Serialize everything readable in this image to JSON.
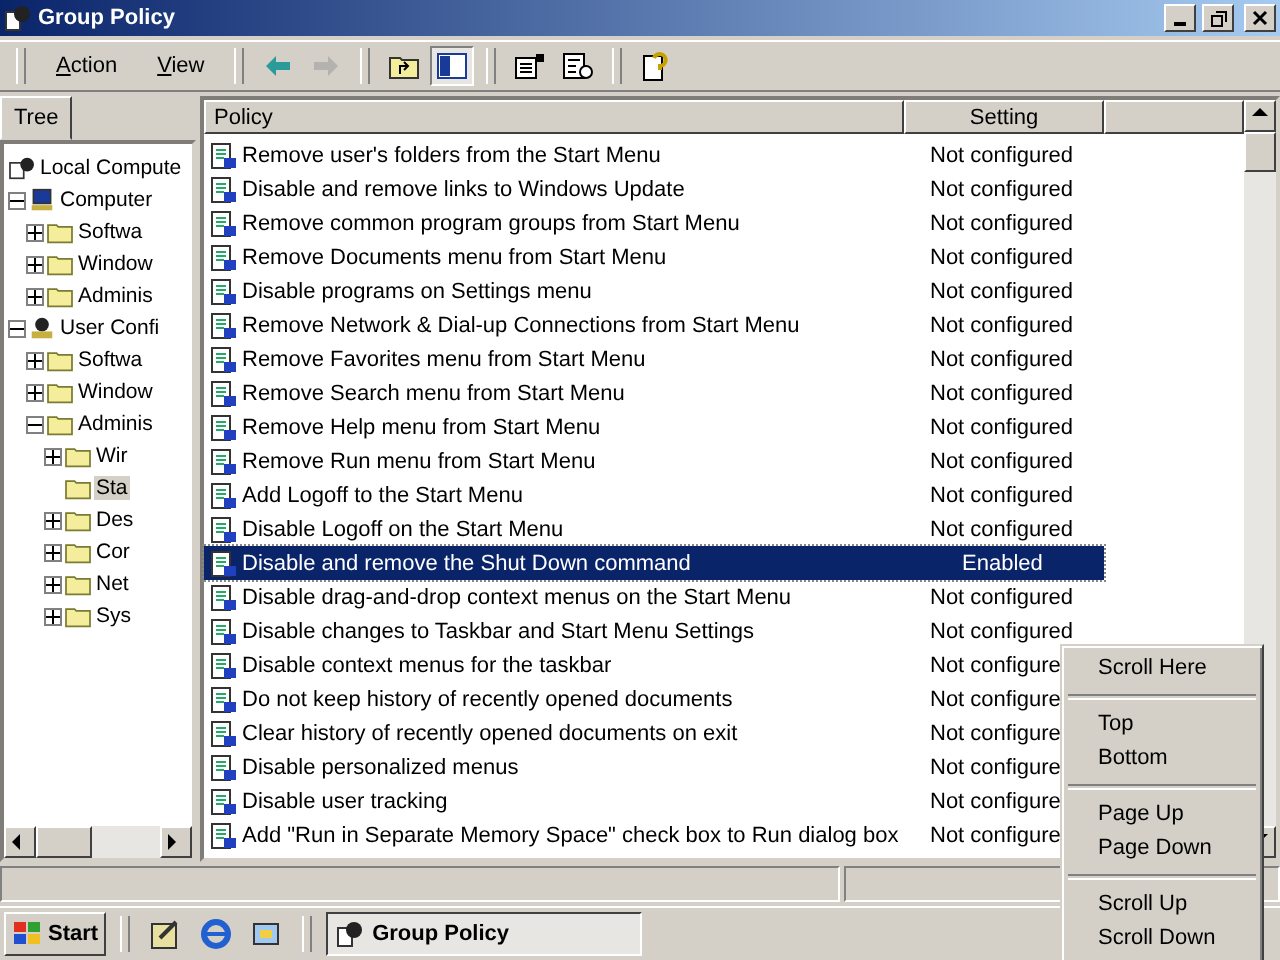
{
  "window": {
    "title": "Group Policy"
  },
  "menu": [
    "Action",
    "View"
  ],
  "toolbar": [
    {
      "kind": "back",
      "disabled": false
    },
    {
      "kind": "forward",
      "disabled": true
    },
    {
      "kind": "sep"
    },
    {
      "kind": "up",
      "disabled": false
    },
    {
      "kind": "tree",
      "disabled": false,
      "pressed": true
    },
    {
      "kind": "sep"
    },
    {
      "kind": "properties",
      "disabled": false
    },
    {
      "kind": "export",
      "disabled": false
    },
    {
      "kind": "sep"
    },
    {
      "kind": "help",
      "disabled": false
    }
  ],
  "tabs": [
    {
      "label": "Tree",
      "selected": true
    }
  ],
  "tree": [
    {
      "label": "Local Compute",
      "kind": "root",
      "selected": false,
      "children": [
        {
          "label": "Computer",
          "kind": "computer",
          "expanded": true,
          "selected": false,
          "children": [
            {
              "label": "Softwa",
              "kind": "folder",
              "expanded": false,
              "selected": false
            },
            {
              "label": "Window",
              "kind": "folder",
              "expanded": false,
              "selected": false
            },
            {
              "label": "Adminis",
              "kind": "folder",
              "expanded": false,
              "selected": false
            }
          ]
        },
        {
          "label": "User Confi",
          "kind": "user",
          "expanded": true,
          "selected": false,
          "children": [
            {
              "label": "Softwa",
              "kind": "folder",
              "expanded": false,
              "selected": false
            },
            {
              "label": "Window",
              "kind": "folder",
              "expanded": false,
              "selected": false
            },
            {
              "label": "Adminis",
              "kind": "folder",
              "expanded": true,
              "selected": false,
              "children": [
                {
                  "label": "Wir",
                  "kind": "folder",
                  "expanded": false,
                  "selected": false
                },
                {
                  "label": "Sta",
                  "kind": "folder",
                  "selected": true
                },
                {
                  "label": "Des",
                  "kind": "folder",
                  "expanded": false,
                  "selected": false
                },
                {
                  "label": "Cor",
                  "kind": "folder",
                  "expanded": false,
                  "selected": false
                },
                {
                  "label": "Net",
                  "kind": "folder",
                  "expanded": false,
                  "selected": false
                },
                {
                  "label": "Sys",
                  "kind": "folder",
                  "expanded": false,
                  "selected": false
                }
              ]
            }
          ]
        }
      ]
    }
  ],
  "table": {
    "columns": [
      "Policy",
      "Setting"
    ],
    "rows": [
      {
        "policy": "Remove user's folders from the Start Menu",
        "setting": "Not configured",
        "selected": false
      },
      {
        "policy": "Disable and remove links to Windows Update",
        "setting": "Not configured",
        "selected": false
      },
      {
        "policy": "Remove common program groups from Start Menu",
        "setting": "Not configured",
        "selected": false
      },
      {
        "policy": "Remove Documents menu from Start Menu",
        "setting": "Not configured",
        "selected": false
      },
      {
        "policy": "Disable programs on Settings menu",
        "setting": "Not configured",
        "selected": false
      },
      {
        "policy": "Remove Network & Dial-up Connections from Start Menu",
        "setting": "Not configured",
        "selected": false
      },
      {
        "policy": "Remove Favorites menu from Start Menu",
        "setting": "Not configured",
        "selected": false
      },
      {
        "policy": "Remove Search menu from Start Menu",
        "setting": "Not configured",
        "selected": false
      },
      {
        "policy": "Remove Help menu from Start Menu",
        "setting": "Not configured",
        "selected": false
      },
      {
        "policy": "Remove Run menu from Start Menu",
        "setting": "Not configured",
        "selected": false
      },
      {
        "policy": "Add Logoff to the Start Menu",
        "setting": "Not configured",
        "selected": false
      },
      {
        "policy": "Disable Logoff on the Start Menu",
        "setting": "Not configured",
        "selected": false
      },
      {
        "policy": "Disable and remove the Shut Down command",
        "setting": "Enabled",
        "selected": true
      },
      {
        "policy": "Disable drag-and-drop context menus on the Start Menu",
        "setting": "Not configured",
        "selected": false
      },
      {
        "policy": "Disable changes to Taskbar and Start Menu Settings",
        "setting": "Not configured",
        "selected": false
      },
      {
        "policy": "Disable context menus for the taskbar",
        "setting": "Not configure",
        "selected": false
      },
      {
        "policy": "Do not keep history of recently opened documents",
        "setting": "Not configure",
        "selected": false
      },
      {
        "policy": "Clear history of recently opened documents on exit",
        "setting": "Not configure",
        "selected": false
      },
      {
        "policy": "Disable personalized menus",
        "setting": "Not configure",
        "selected": false
      },
      {
        "policy": "Disable user tracking",
        "setting": "Not configure",
        "selected": false
      },
      {
        "policy": "Add \"Run in Separate Memory Space\" check box to Run dialog box",
        "setting": "Not configure",
        "selected": false
      }
    ]
  },
  "context_menu": [
    {
      "kind": "item",
      "label": "Scroll Here"
    },
    {
      "kind": "sep"
    },
    {
      "kind": "item",
      "label": "Top"
    },
    {
      "kind": "item",
      "label": "Bottom"
    },
    {
      "kind": "sep"
    },
    {
      "kind": "item",
      "label": "Page Up"
    },
    {
      "kind": "item",
      "label": "Page Down"
    },
    {
      "kind": "sep"
    },
    {
      "kind": "item",
      "label": "Scroll Up"
    },
    {
      "kind": "item",
      "label": "Scroll Down"
    }
  ],
  "taskbar": {
    "start": "Start",
    "quick_launch": [
      {
        "kind": "desktop"
      },
      {
        "kind": "browser"
      },
      {
        "kind": "channels"
      }
    ],
    "tasks": [
      {
        "label": "Group Policy",
        "selected": true
      }
    ]
  }
}
